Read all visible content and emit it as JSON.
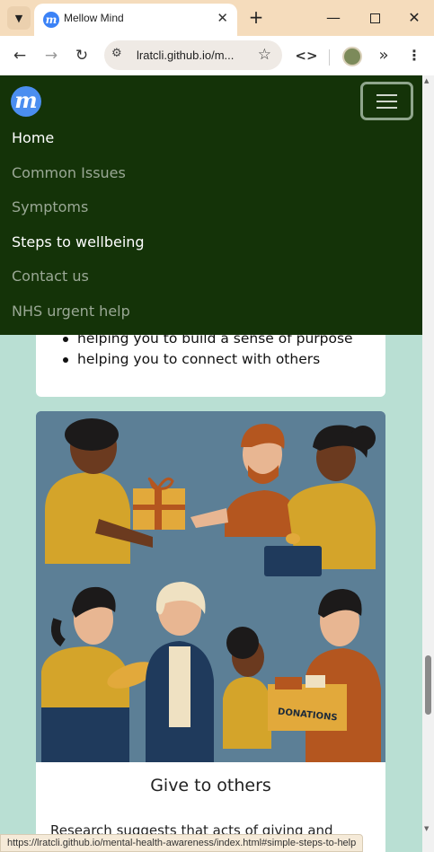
{
  "browser": {
    "tab_title": "Mellow Mind",
    "favicon_letter": "m",
    "new_tab_symbol": "+",
    "url": "lratcli.github.io/m...",
    "status_url": "https://lratcli.github.io/mental-health-awareness/index.html#simple-steps-to-help"
  },
  "nav": {
    "brand_letter": "m",
    "items": [
      {
        "label": "Home",
        "active": true
      },
      {
        "label": "Common Issues",
        "active": false
      },
      {
        "label": "Symptoms",
        "active": false
      },
      {
        "label": "Steps to wellbeing",
        "active": true
      },
      {
        "label": "Contact us",
        "active": false
      },
      {
        "label": "NHS urgent help",
        "active": false
      }
    ]
  },
  "content": {
    "list_items": [
      "helping you to build a sense of purpose",
      "helping you to connect with others"
    ],
    "give_card": {
      "title": "Give to others",
      "text_partial": "Research suggests that acts of giving and",
      "illustration_box_text": "DONATIONS"
    }
  },
  "colors": {
    "navbar_bg": "#143308",
    "page_bg": "#b9dfd3",
    "brand_blue": "#4b8ef0",
    "tab_bar": "#f5dcbc"
  }
}
